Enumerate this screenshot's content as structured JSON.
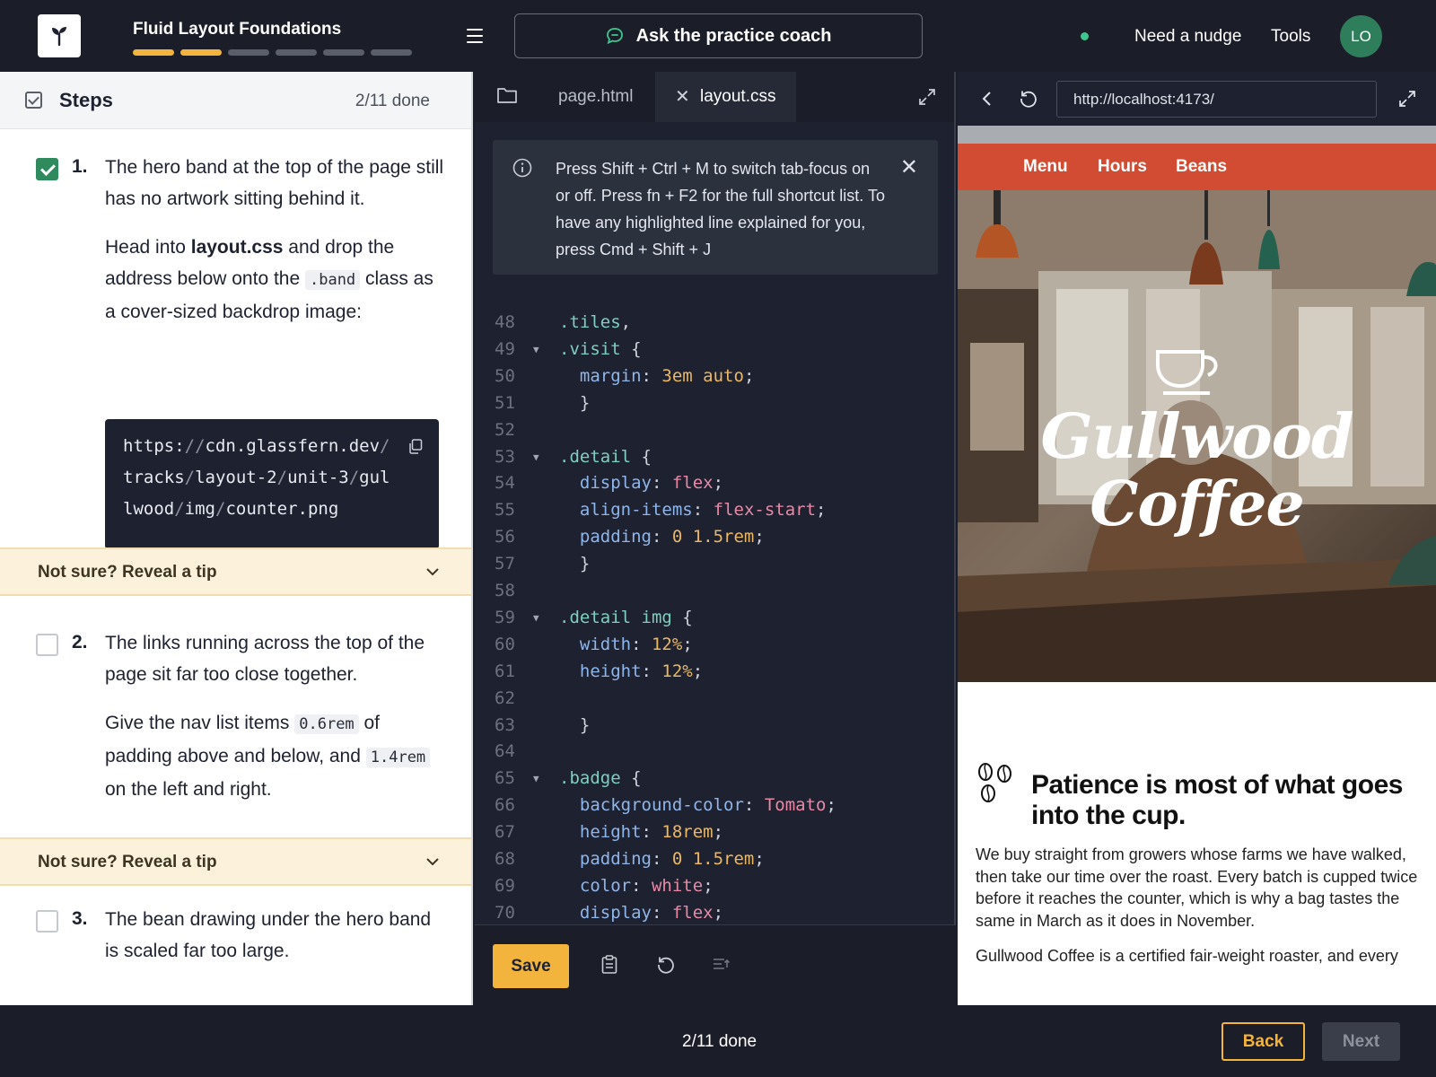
{
  "header": {
    "course_title": "Fluid Layout Foundations",
    "progress_segments": 6,
    "progress_done": 2,
    "coach_label": "Ask the practice coach",
    "nudge_label": "Need a nudge",
    "tools_label": "Tools",
    "avatar_initials": "LO",
    "accent_color": "#f2b43c",
    "status_color": "#3fc78f"
  },
  "steps_panel": {
    "title": "Steps",
    "count": "2/11 done",
    "steps": [
      {
        "number": "1.",
        "done": true,
        "prompt": "The hero band at the top of the page still has no artwork sitting behind it.",
        "detail_pre": "Head into ",
        "detail_bold": "layout.css",
        "detail_mid": " and drop the address below onto the ",
        "detail_code": ".band",
        "detail_post": " class as a cover-sized backdrop image:",
        "code_lines": [
          "https://cdn.glassfern.dev/",
          "tracks/layout-2/unit-3/gul",
          "lwood/img/counter.png"
        ]
      },
      {
        "number": "2.",
        "done": false,
        "prompt": "The links running across the top of the page sit far too close together.",
        "detail_pre": "Give the nav list items ",
        "detail_code1": "0.6rem",
        "detail_mid": " of padding above and below, and ",
        "detail_code2": "1.4rem",
        "detail_post": " on the left and right."
      },
      {
        "number": "3.",
        "done": false,
        "prompt": "The bean drawing under the hero band is scaled far too large."
      }
    ],
    "tip_label": "Not sure? Reveal a tip"
  },
  "editor": {
    "tabs": [
      {
        "label": "page.html",
        "active": false
      },
      {
        "label": "layout.css",
        "active": true
      }
    ],
    "notice": "Press Shift + Ctrl + M to switch tab-focus on or off. Press fn + F2 for the full shortcut list. To have any highlighted line explained for you, press Cmd + Shift + J",
    "save_label": "Save",
    "lines": [
      {
        "n": "48",
        "fold": false,
        "parts": [
          [
            "sel",
            ".tiles"
          ],
          [
            "punc",
            ","
          ]
        ]
      },
      {
        "n": "49",
        "fold": true,
        "parts": [
          [
            "sel",
            ".visit"
          ],
          [
            "punc",
            " {"
          ]
        ]
      },
      {
        "n": "50",
        "fold": false,
        "parts": [
          [
            "sp",
            "  "
          ],
          [
            "prop",
            "margin"
          ],
          [
            "punc",
            ": "
          ],
          [
            "val",
            "3em auto"
          ],
          [
            "punc",
            ";"
          ]
        ]
      },
      {
        "n": "51",
        "fold": false,
        "parts": [
          [
            "sp",
            "  "
          ],
          [
            "punc",
            "}"
          ]
        ]
      },
      {
        "n": "52",
        "fold": false,
        "parts": []
      },
      {
        "n": "53",
        "fold": true,
        "parts": [
          [
            "sel",
            ".detail"
          ],
          [
            "punc",
            " {"
          ]
        ]
      },
      {
        "n": "54",
        "fold": false,
        "parts": [
          [
            "sp",
            "  "
          ],
          [
            "prop",
            "display"
          ],
          [
            "punc",
            ": "
          ],
          [
            "kw",
            "flex"
          ],
          [
            "punc",
            ";"
          ]
        ]
      },
      {
        "n": "55",
        "fold": false,
        "parts": [
          [
            "sp",
            "  "
          ],
          [
            "prop",
            "align-items"
          ],
          [
            "punc",
            ": "
          ],
          [
            "kw",
            "flex-start"
          ],
          [
            "punc",
            ";"
          ]
        ]
      },
      {
        "n": "56",
        "fold": false,
        "parts": [
          [
            "sp",
            "  "
          ],
          [
            "prop",
            "padding"
          ],
          [
            "punc",
            ": "
          ],
          [
            "val",
            "0 1.5rem"
          ],
          [
            "punc",
            ";"
          ]
        ]
      },
      {
        "n": "57",
        "fold": false,
        "parts": [
          [
            "sp",
            "  "
          ],
          [
            "punc",
            "}"
          ]
        ]
      },
      {
        "n": "58",
        "fold": false,
        "parts": []
      },
      {
        "n": "59",
        "fold": true,
        "parts": [
          [
            "sel",
            ".detail img"
          ],
          [
            "punc",
            " {"
          ]
        ]
      },
      {
        "n": "60",
        "fold": false,
        "parts": [
          [
            "sp",
            "  "
          ],
          [
            "prop",
            "width"
          ],
          [
            "punc",
            ": "
          ],
          [
            "val",
            "12%"
          ],
          [
            "punc",
            ";"
          ]
        ]
      },
      {
        "n": "61",
        "fold": false,
        "parts": [
          [
            "sp",
            "  "
          ],
          [
            "prop",
            "height"
          ],
          [
            "punc",
            ": "
          ],
          [
            "val",
            "12%"
          ],
          [
            "punc",
            ";"
          ]
        ]
      },
      {
        "n": "62",
        "fold": false,
        "parts": []
      },
      {
        "n": "63",
        "fold": false,
        "parts": [
          [
            "sp",
            "  "
          ],
          [
            "punc",
            "}"
          ]
        ]
      },
      {
        "n": "64",
        "fold": false,
        "parts": []
      },
      {
        "n": "65",
        "fold": true,
        "parts": [
          [
            "sel",
            ".badge"
          ],
          [
            "punc",
            " {"
          ]
        ]
      },
      {
        "n": "66",
        "fold": false,
        "parts": [
          [
            "sp",
            "  "
          ],
          [
            "prop",
            "background-color"
          ],
          [
            "punc",
            ": "
          ],
          [
            "kw",
            "Tomato"
          ],
          [
            "punc",
            ";"
          ]
        ]
      },
      {
        "n": "67",
        "fold": false,
        "parts": [
          [
            "sp",
            "  "
          ],
          [
            "prop",
            "height"
          ],
          [
            "punc",
            ": "
          ],
          [
            "val",
            "18rem"
          ],
          [
            "punc",
            ";"
          ]
        ]
      },
      {
        "n": "68",
        "fold": false,
        "parts": [
          [
            "sp",
            "  "
          ],
          [
            "prop",
            "padding"
          ],
          [
            "punc",
            ": "
          ],
          [
            "val",
            "0 1.5rem"
          ],
          [
            "punc",
            ";"
          ]
        ]
      },
      {
        "n": "69",
        "fold": false,
        "parts": [
          [
            "sp",
            "  "
          ],
          [
            "prop",
            "color"
          ],
          [
            "punc",
            ": "
          ],
          [
            "kw",
            "white"
          ],
          [
            "punc",
            ";"
          ]
        ]
      },
      {
        "n": "70",
        "fold": false,
        "parts": [
          [
            "sp",
            "  "
          ],
          [
            "prop",
            "display"
          ],
          [
            "punc",
            ": "
          ],
          [
            "kw",
            "flex"
          ],
          [
            "punc",
            ";"
          ]
        ]
      }
    ]
  },
  "preview": {
    "url": "http://localhost:4173/",
    "nav_items": [
      "Menu",
      "Hours",
      "Beans"
    ],
    "brand_line1": "Gullwood",
    "brand_line2": "Coffee",
    "article_title": "Patience is most of what goes into the cup.",
    "article_p1": "We buy straight from growers whose farms we have walked, then take our time over the roast. Every batch is cupped twice before it reaches the counter, which is why a bag tastes the same in March as it does in November.",
    "article_p2": "Gullwood Coffee is a certified fair-weight roaster, and every"
  },
  "footer": {
    "count": "2/11 done",
    "back_label": "Back",
    "next_label": "Next"
  }
}
